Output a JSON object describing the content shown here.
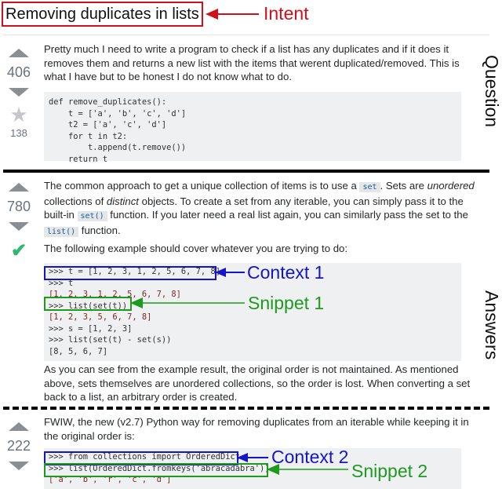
{
  "question": {
    "title": "Removing duplicates in lists",
    "score": "406",
    "favorites": "138",
    "body": "Pretty much I need to write a program to check if a list has any duplicates and if it does it removes them and returns a new list with the items that werent duplicated/removed. This is what I have but to be honest I do not know what to do.",
    "code_lines": [
      "def remove_duplicates():",
      "    t = ['a', 'b', 'c', 'd']",
      "    t2 = ['a', 'c', 'd']",
      "    for t in t2:",
      "        t.append(t.remove())",
      "    return t"
    ]
  },
  "answers": [
    {
      "score": "780",
      "accepted": true,
      "p1": {
        "a": "The common approach to get a unique collection of items is to use a ",
        "code1": "set",
        "b": ". Sets are ",
        "em1": "unordered",
        "c": " collections of ",
        "em2": "distinct",
        "d": " objects. To create a set from any iterable, you can simply pass it to the built-in ",
        "code2": "set()",
        "e": " function. If you later need a real list again, you can similarly pass the set to the ",
        "code3": "list()",
        "f": " function."
      },
      "p2": "The following example should cover whatever you are trying to do:",
      "code_lines": [
        ">>> t = [1, 2, 3, 1, 2, 5, 6, 7, 8]",
        ">>> t",
        "[1, 2, 3, 1, 2, 5, 6, 7, 8]",
        ">>> list(set(t))",
        "[1, 2, 3, 5, 6, 7, 8]",
        ">>> s = [1, 2, 3]",
        ">>> list(set(t) - set(s))",
        "[8, 5, 6, 7]"
      ],
      "p3": "As you can see from the example result, the original order is not maintained. As mentioned above, sets themselves are unordered collections, so the order is lost. When converting a set back to a list, an arbitrary order is created."
    },
    {
      "score": "222",
      "p1": "FWIW, the new (v2.7) Python way for removing duplicates from an iterable while keeping it in the original order is:",
      "code_lines": [
        ">>> from collections import OrderedDict",
        ">>> list(OrderedDict.fromkeys('abracadabra'))",
        "['a', 'b', 'r', 'c', 'd']"
      ]
    }
  ],
  "annotations": {
    "intent": "Intent",
    "context1": "Context 1",
    "snippet1": "Snippet 1",
    "context2": "Context 2",
    "snippet2": "Snippet 2",
    "question_label": "Question",
    "answers_label": "Answers"
  },
  "colors": {
    "intent": "#d0101a",
    "context": "#1515c8",
    "snippet": "#1e9a1e",
    "accepted": "#2eb872"
  }
}
